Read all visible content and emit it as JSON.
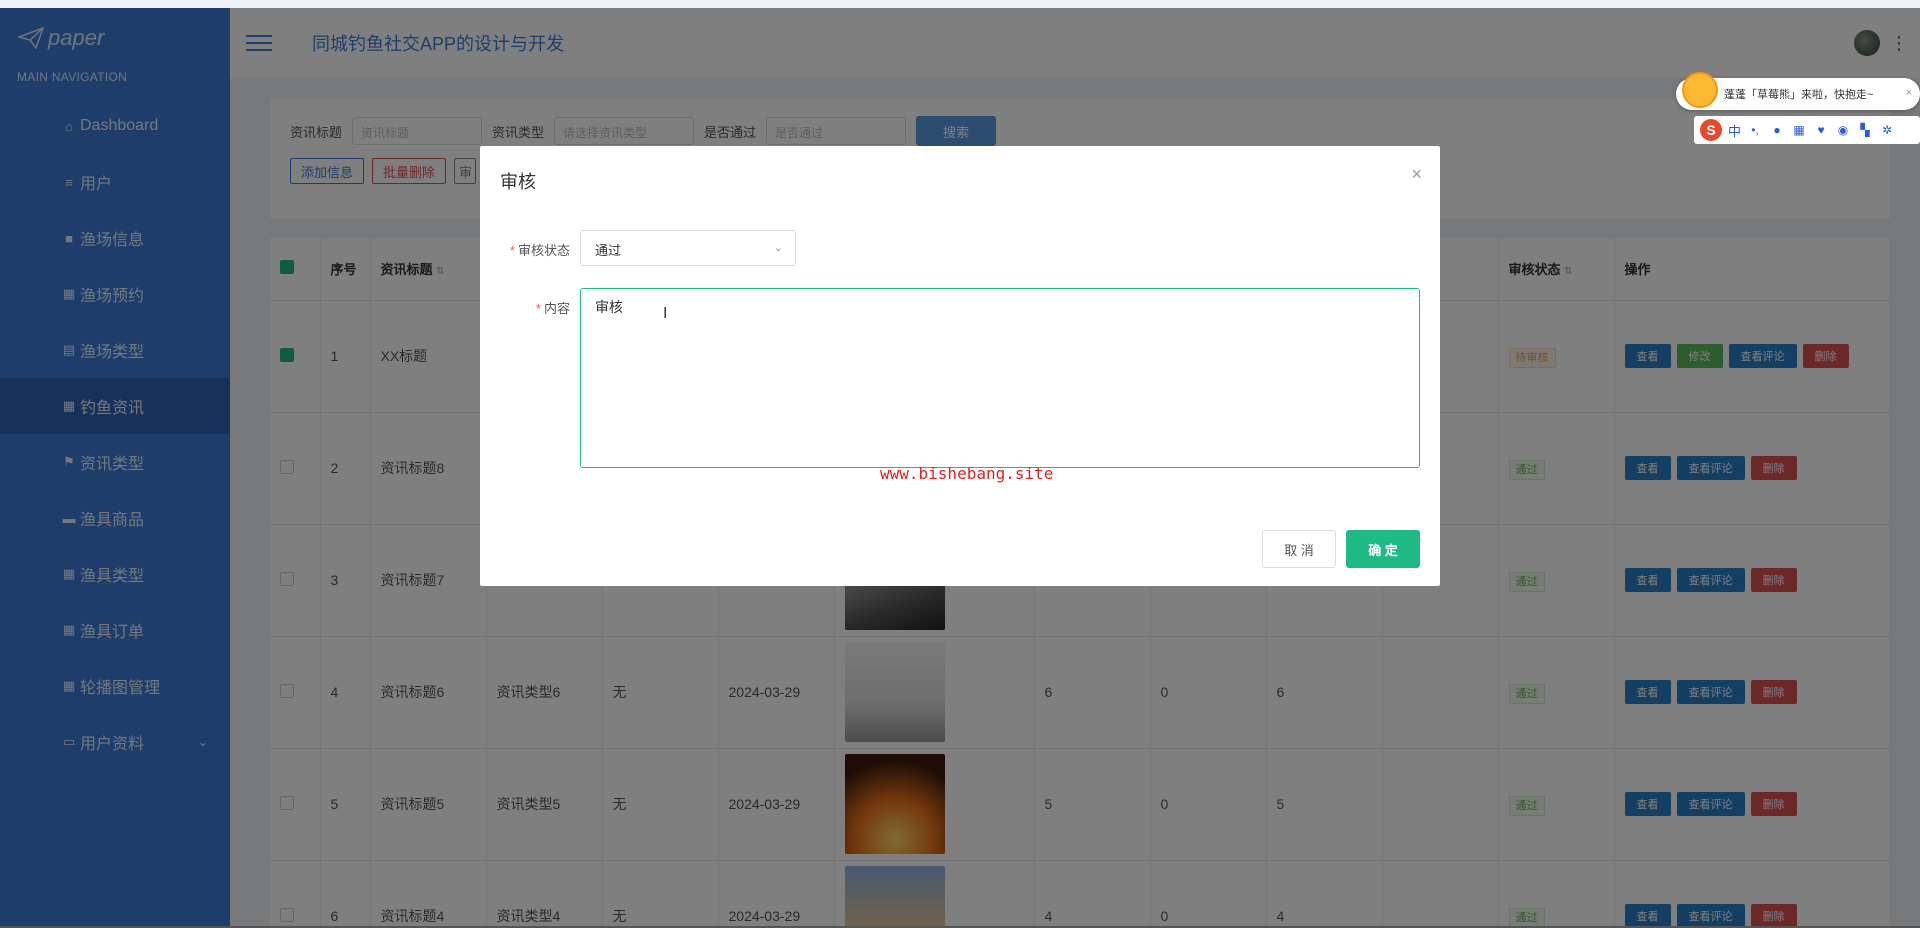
{
  "sidebar": {
    "brand": "paper",
    "heading": "MAIN NAVIGATION",
    "items": [
      {
        "label": "Dashboard",
        "icon": "⌂"
      },
      {
        "label": "用户",
        "icon": "≡"
      },
      {
        "label": "渔场信息",
        "icon": "■"
      },
      {
        "label": "渔场预约",
        "icon": "▦"
      },
      {
        "label": "渔场类型",
        "icon": "▤"
      },
      {
        "label": "钓鱼资讯",
        "icon": "▦"
      },
      {
        "label": "资讯类型",
        "icon": "⚑"
      },
      {
        "label": "渔具商品",
        "icon": "▬"
      },
      {
        "label": "渔具类型",
        "icon": "▦"
      },
      {
        "label": "渔具订单",
        "icon": "▦"
      },
      {
        "label": "轮播图管理",
        "icon": "▦"
      },
      {
        "label": "用户资料",
        "icon": "▭"
      }
    ]
  },
  "header": {
    "title": "同城钓鱼社交APP的设计与开发"
  },
  "search": {
    "label_title": "资讯标题",
    "placeholder_title": "资讯标题",
    "label_type": "资讯类型",
    "placeholder_type": "请选择资讯类型",
    "label_pass": "是否通过",
    "placeholder_pass": "是否通过",
    "search_button": "搜索",
    "add_button": "添加信息",
    "batch_delete_button": "批量删除",
    "extra_button": "审"
  },
  "table": {
    "headers": [
      "序号",
      "资讯标题",
      "审核状态",
      "操作"
    ],
    "rows": [
      {
        "no": "1",
        "title": "XX标题",
        "type": "",
        "none": "",
        "date": "",
        "a": "",
        "b": "",
        "c": "",
        "status": "待审核"
      },
      {
        "no": "2",
        "title": "资讯标题8",
        "type": "",
        "none": "",
        "date": "",
        "a": "",
        "b": "",
        "c": "",
        "status": "通过"
      },
      {
        "no": "3",
        "title": "资讯标题7",
        "type": "",
        "none": "",
        "date": "",
        "a": "",
        "b": "",
        "c": "",
        "status": "通过"
      },
      {
        "no": "4",
        "title": "资讯标题6",
        "type": "资讯类型6",
        "none": "无",
        "date": "2024-03-29",
        "a": "6",
        "b": "0",
        "c": "6",
        "status": "通过"
      },
      {
        "no": "5",
        "title": "资讯标题5",
        "type": "资讯类型5",
        "none": "无",
        "date": "2024-03-29",
        "a": "5",
        "b": "0",
        "c": "5",
        "status": "通过"
      },
      {
        "no": "6",
        "title": "资讯标题4",
        "type": "资讯类型4",
        "none": "无",
        "date": "2024-03-29",
        "a": "4",
        "b": "0",
        "c": "4",
        "status": "通过"
      }
    ],
    "actions": {
      "view": "查看",
      "edit": "修改",
      "comments": "查看评论",
      "delete": "删除"
    }
  },
  "modal": {
    "title": "审核",
    "close_icon": "×",
    "status_label": "审核状态",
    "status_value": "通过",
    "content_label": "内容",
    "content_value": "审核",
    "cancel_button": "取 消",
    "confirm_button": "确 定"
  },
  "watermark": "www.bishebang.site",
  "ime": {
    "message": "蓬蓬「草莓熊」来啦，快抱走~",
    "mode": "中",
    "punct": "•,"
  },
  "colors": {
    "sidebar": "#3c7bd6",
    "accent": "#1fb985",
    "danger": "#d9534f",
    "primary": "#2a7fc4"
  }
}
